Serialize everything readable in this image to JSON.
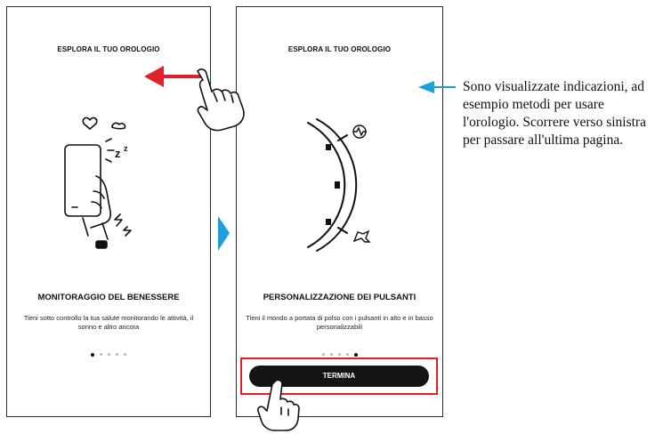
{
  "screen1": {
    "header": "ESPLORA IL TUO OROLOGIO",
    "title": "MONITORAGGIO DEL BENESSERE",
    "description": "Tieni sotto controllo la tua salute monitorando le attività, il sonno e altro ancora",
    "page_indicator": {
      "total": 5,
      "active": 1
    }
  },
  "screen2": {
    "header": "ESPLORA IL TUO OROLOGIO",
    "title": "PERSONALIZZAZIONE DEI PULSANTI",
    "description": "Tieni il mondo a portata di polso con i pulsanti in alto e in basso personalizzabili",
    "page_indicator": {
      "total": 5,
      "active": 5
    },
    "finish_button": "TERMINA"
  },
  "annotation": {
    "text": "Sono visualizzate indicazioni, ad esempio metodi per usare l'orologio. Scorrere verso sinistra per passare all'ultima pagina."
  },
  "colors": {
    "swipe_arrow": "#e0202a",
    "next_arrow": "#1a9fe0",
    "callout_arrow": "#1a9fe0",
    "highlight_frame": "#e0202a",
    "button_bg": "#141414"
  },
  "icons": [
    "hand-swipe-icon",
    "hand-tap-icon",
    "heart-icon",
    "sleep-icon",
    "heartbeat-icon",
    "activity-icon"
  ]
}
